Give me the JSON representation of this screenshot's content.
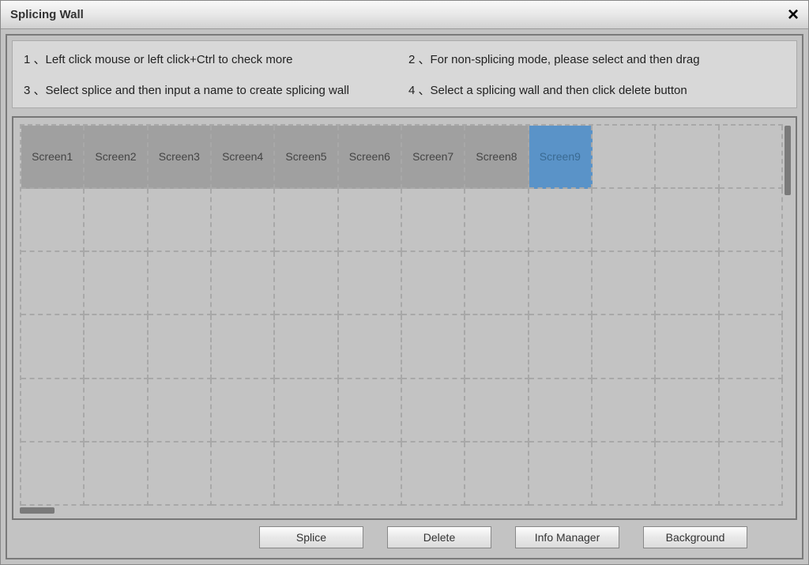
{
  "titlebar": {
    "title": "Splicing Wall",
    "close_glyph": "×"
  },
  "instructions": {
    "i1": "1 、Left click mouse or left click+Ctrl to check more",
    "i2": "2 、For non-splicing mode, please select and then drag",
    "i3": "3 、Select splice and then input a name to create splicing wall",
    "i4": "4 、Select a splicing wall and then click delete button"
  },
  "grid": {
    "cols": 12,
    "rows": 6,
    "screens": [
      {
        "label": "Screen1",
        "col": 0,
        "row": 0,
        "state": "filled"
      },
      {
        "label": "Screen2",
        "col": 1,
        "row": 0,
        "state": "filled"
      },
      {
        "label": "Screen3",
        "col": 2,
        "row": 0,
        "state": "filled"
      },
      {
        "label": "Screen4",
        "col": 3,
        "row": 0,
        "state": "filled"
      },
      {
        "label": "Screen5",
        "col": 4,
        "row": 0,
        "state": "filled"
      },
      {
        "label": "Screen6",
        "col": 5,
        "row": 0,
        "state": "filled"
      },
      {
        "label": "Screen7",
        "col": 6,
        "row": 0,
        "state": "filled"
      },
      {
        "label": "Screen8",
        "col": 7,
        "row": 0,
        "state": "filled"
      },
      {
        "label": "Screen9",
        "col": 8,
        "row": 0,
        "state": "selected"
      }
    ]
  },
  "buttons": {
    "splice": "Splice",
    "delete": "Delete",
    "info_manager": "Info Manager",
    "background": "Background"
  }
}
